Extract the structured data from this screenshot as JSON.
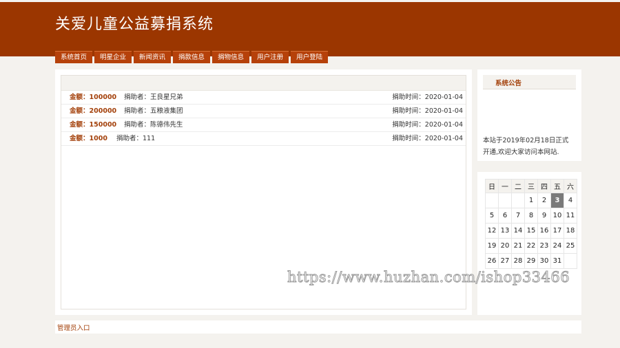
{
  "header": {
    "title": "关爱儿童公益募捐系统"
  },
  "nav": [
    {
      "label": "系统首页"
    },
    {
      "label": "明星企业"
    },
    {
      "label": "新闻资讯"
    },
    {
      "label": "捐款信息"
    },
    {
      "label": "捐物信息"
    },
    {
      "label": "用户注册"
    },
    {
      "label": "用户登陆"
    }
  ],
  "donations": [
    {
      "amount": "金额：100000",
      "donor": "捐助者：王良星兄弟",
      "time": "捐助时间：2020-01-04"
    },
    {
      "amount": "金额：200000",
      "donor": "捐助者：五粮液集团",
      "time": "捐助时间：2020-01-04"
    },
    {
      "amount": "金额：150000",
      "donor": "捐助者：陈德伟先生",
      "time": "捐助时间：2020-01-04"
    },
    {
      "amount": "金额：1000",
      "donor": "捐助者：111",
      "time": "捐助时间：2020-01-04"
    }
  ],
  "announcement": {
    "title": "系统公告",
    "text": "本站于2019年02月18日正式开通,欢迎大家访问本网站."
  },
  "calendar": {
    "weekdays": [
      "日",
      "一",
      "二",
      "三",
      "四",
      "五",
      "六"
    ],
    "weeks": [
      [
        "",
        "",
        "",
        "1",
        "2",
        "3",
        "4"
      ],
      [
        "5",
        "6",
        "7",
        "8",
        "9",
        "10",
        "11"
      ],
      [
        "12",
        "13",
        "14",
        "15",
        "16",
        "17",
        "18"
      ],
      [
        "19",
        "20",
        "21",
        "22",
        "23",
        "24",
        "25"
      ],
      [
        "26",
        "27",
        "28",
        "29",
        "30",
        "31",
        ""
      ]
    ],
    "today": "3"
  },
  "footer": {
    "admin_link": "管理员入口"
  },
  "watermark": "https://www.huzhan.com/ishop33466"
}
